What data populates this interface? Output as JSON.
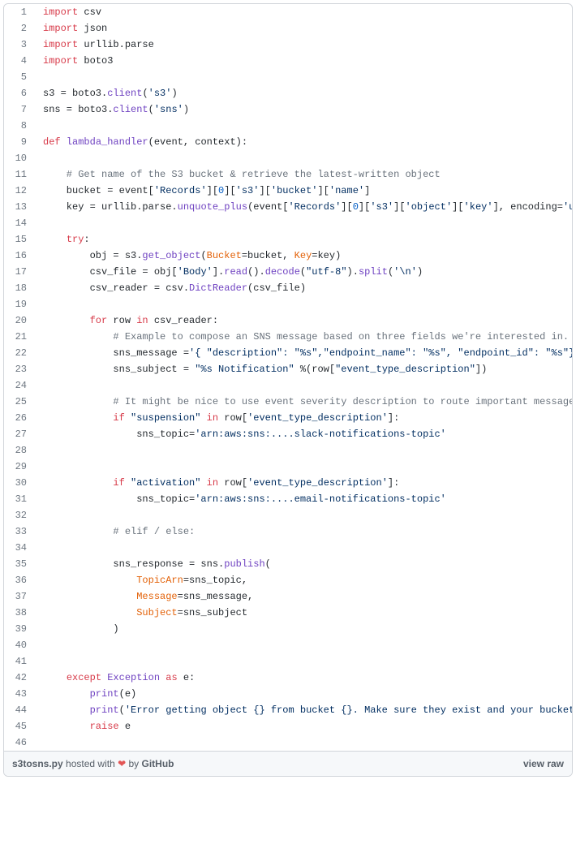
{
  "filename": "s3tosns.py",
  "hosted_text": " hosted with ",
  "heart": "❤",
  "by_text": " by ",
  "host": "GitHub",
  "view_raw": "view raw",
  "lines": {
    "l1": {
      "kw": "import",
      "m": " csv"
    },
    "l2": {
      "kw": "import",
      "m": " json"
    },
    "l3": {
      "kw": "import",
      "m": " urllib.parse"
    },
    "l4": {
      "kw": "import",
      "m": " boto3"
    },
    "l6": {
      "a": "s3 = boto3.",
      "fn": "client",
      "b": "(",
      "s": "'s3'",
      "c": ")"
    },
    "l7": {
      "a": "sns = boto3.",
      "fn": "client",
      "b": "(",
      "s": "'sns'",
      "c": ")"
    },
    "l9": {
      "kw": "def",
      "sp": " ",
      "fn": "lambda_handler",
      "a": "(event, context):"
    },
    "l11": "    # Get name of the S3 bucket & retrieve the latest-written object",
    "l12": {
      "a": "    bucket = event[",
      "s1": "'Records'",
      "b": "][",
      "n": "0",
      "c": "][",
      "s2": "'s3'",
      "d": "][",
      "s3": "'bucket'",
      "e": "][",
      "s4": "'name'",
      "f": "]"
    },
    "l13": {
      "a": "    key = urllib.parse.",
      "fn": "unquote_plus",
      "b": "(event[",
      "s1": "'Records'",
      "c": "][",
      "n": "0",
      "d": "][",
      "s2": "'s3'",
      "e": "][",
      "s3": "'object'",
      "f": "][",
      "s4": "'key'",
      "g": "], encoding=",
      "s5": "'ut"
    },
    "l15": {
      "a": "    ",
      "kw": "try",
      "b": ":"
    },
    "l16": {
      "a": "        obj = s3.",
      "fn": "get_object",
      "b": "(",
      "p1": "Bucket",
      "c": "=bucket, ",
      "p2": "Key",
      "d": "=key)"
    },
    "l17": {
      "a": "        csv_file = obj[",
      "s1": "'Body'",
      "b": "].",
      "fn1": "read",
      "c": "().",
      "fn2": "decode",
      "d": "(",
      "s2": "\"utf-8\"",
      "e": ").",
      "fn3": "split",
      "f": "(",
      "s3": "'\\n'",
      "g": ")"
    },
    "l18": {
      "a": "        csv_reader = csv.",
      "fn": "DictReader",
      "b": "(csv_file)"
    },
    "l20": {
      "a": "        ",
      "kw1": "for",
      "b": " row ",
      "kw2": "in",
      "c": " csv_reader:"
    },
    "l21": "            # Example to compose an SNS message based on three fields we're interested in.",
    "l22": {
      "a": "            sns_message =",
      "s": "'{ \"description\": \"%s\",\"endpoint_name\": \"%s\", \"endpoint_id\": \"%s\"}"
    },
    "l23": {
      "a": "            sns_subject = ",
      "s1": "\"%s Notification\"",
      "b": " %(row[",
      "s2": "\"event_type_description\"",
      "c": "])"
    },
    "l25": "            # It might be nice to use event severity description to route important messages",
    "l26": {
      "a": "            ",
      "kw": "if",
      "b": " ",
      "s1": "\"suspension\"",
      "c": " ",
      "kw2": "in",
      "d": " row[",
      "s2": "'event_type_description'",
      "e": "]:"
    },
    "l27": {
      "a": "                sns_topic=",
      "s": "'arn:aws:sns:....slack-notifications-topic'"
    },
    "l30": {
      "a": "            ",
      "kw": "if",
      "b": " ",
      "s1": "\"activation\"",
      "c": " ",
      "kw2": "in",
      "d": " row[",
      "s2": "'event_type_description'",
      "e": "]:"
    },
    "l31": {
      "a": "                sns_topic=",
      "s": "'arn:aws:sns:....email-notifications-topic'"
    },
    "l33": "            # elif / else:",
    "l35": {
      "a": "            sns_response = sns.",
      "fn": "publish",
      "b": "("
    },
    "l36": {
      "a": "                ",
      "p": "TopicArn",
      "b": "=sns_topic,"
    },
    "l37": {
      "a": "                ",
      "p": "Message",
      "b": "=sns_message,"
    },
    "l38": {
      "a": "                ",
      "p": "Subject",
      "b": "=sns_subject"
    },
    "l39": "            )",
    "l42": {
      "a": "    ",
      "kw1": "except",
      "b": " ",
      "fn": "Exception",
      "c": " ",
      "kw2": "as",
      "d": " e:"
    },
    "l43": {
      "a": "        ",
      "fn": "print",
      "b": "(e)"
    },
    "l44": {
      "a": "        ",
      "fn": "print",
      "b": "(",
      "s": "'Error getting object {} from bucket {}. Make sure they exist and your bucket"
    },
    "l45": {
      "a": "        ",
      "kw": "raise",
      "b": " e"
    }
  },
  "line_numbers": [
    "1",
    "2",
    "3",
    "4",
    "5",
    "6",
    "7",
    "8",
    "9",
    "10",
    "11",
    "12",
    "13",
    "14",
    "15",
    "16",
    "17",
    "18",
    "19",
    "20",
    "21",
    "22",
    "23",
    "24",
    "25",
    "26",
    "27",
    "28",
    "29",
    "30",
    "31",
    "32",
    "33",
    "34",
    "35",
    "36",
    "37",
    "38",
    "39",
    "40",
    "41",
    "42",
    "43",
    "44",
    "45",
    "46"
  ]
}
